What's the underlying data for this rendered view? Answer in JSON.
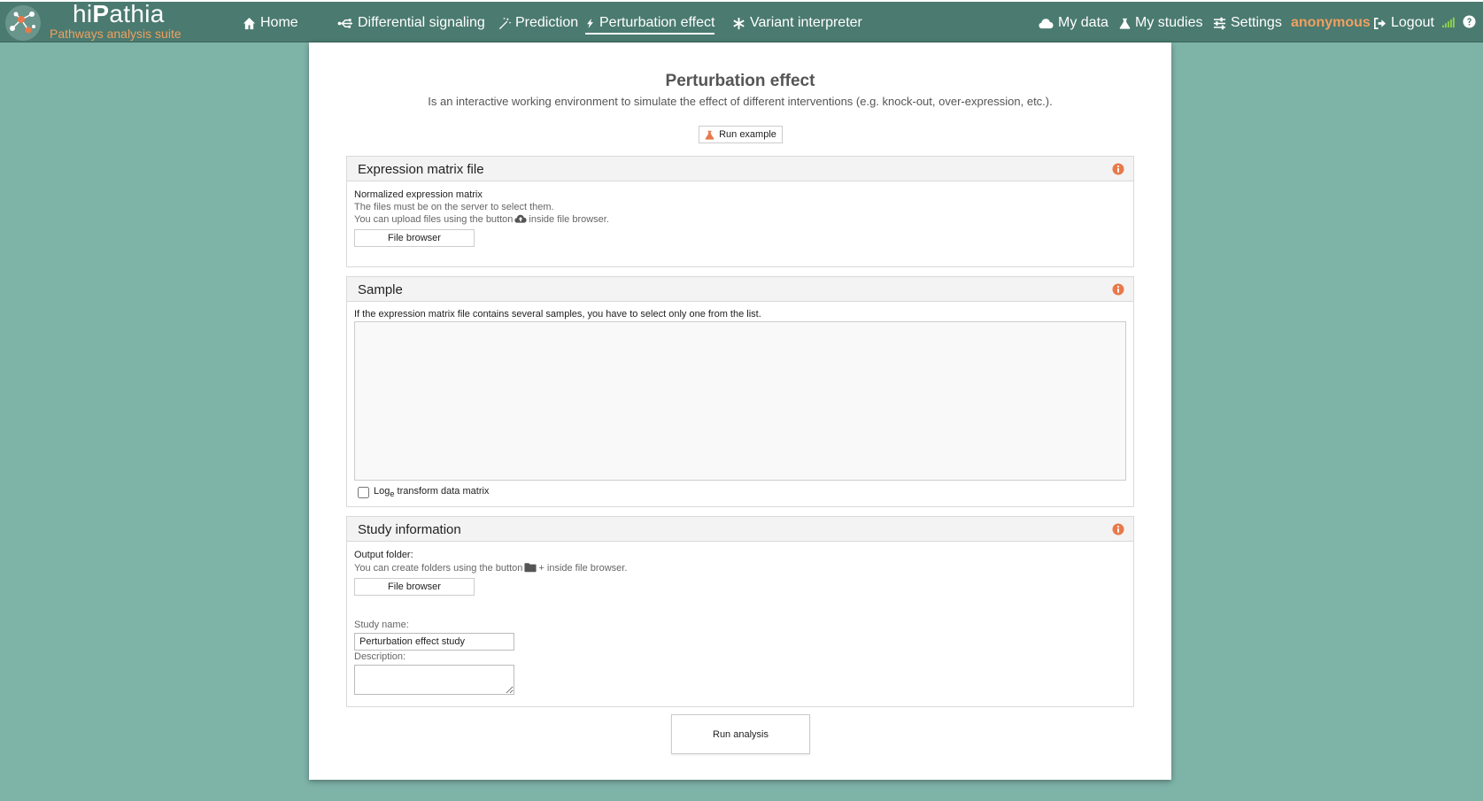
{
  "brand": {
    "name_prefix": "hi",
    "name_bold": "P",
    "name_suffix": "athia",
    "subtitle": "Pathways analysis suite"
  },
  "nav": {
    "home": "Home",
    "differential": "Differential signaling",
    "prediction": "Prediction",
    "perturbation": "Perturbation effect",
    "variant": "Variant interpreter",
    "my_data": "My data",
    "my_studies": "My studies",
    "settings": "Settings",
    "user": "anonymous",
    "logout": "Logout"
  },
  "page": {
    "title": "Perturbation effect",
    "description": "Is an interactive working environment to simulate the effect of different interventions (e.g. knock-out, over-expression, etc.).",
    "run_example": "Run example"
  },
  "expression": {
    "title": "Expression matrix file",
    "label": "Normalized expression matrix",
    "hint1": "The files must be on the server to select them.",
    "hint2_pre": "You can upload files using the button",
    "hint2_post": "inside file browser.",
    "file_button": "File browser"
  },
  "sample": {
    "title": "Sample",
    "hint": "If the expression matrix file contains several samples, you have to select only one from the list.",
    "log_pre": "Log",
    "log_sub": "e",
    "log_post": " transform data matrix"
  },
  "study": {
    "title": "Study information",
    "output_label": "Output folder:",
    "output_hint_pre": "You can create folders using the button",
    "output_hint_post": "+ inside file browser.",
    "file_button": "File browser",
    "name_label": "Study name:",
    "name_value": "Perturbation effect study",
    "desc_label": "Description:"
  },
  "actions": {
    "run_analysis": "Run analysis"
  },
  "colors": {
    "header": "#4a7a70",
    "background": "#7eb3a8",
    "accent": "#f0a060",
    "info": "#e8794a"
  }
}
